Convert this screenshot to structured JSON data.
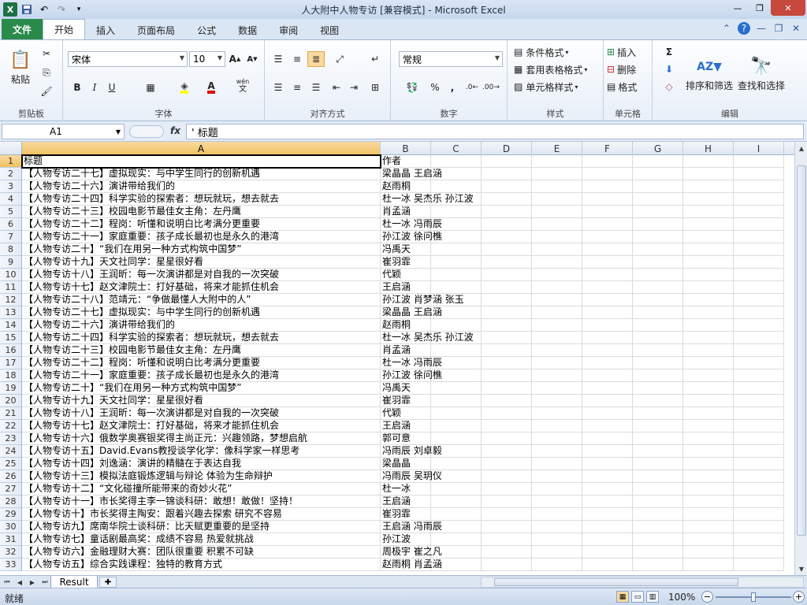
{
  "window": {
    "title": "人大附中人物专访  [兼容模式]  -  Microsoft Excel"
  },
  "qat": {
    "save_icon": "save-icon",
    "undo_icon": "undo-icon",
    "redo_icon": "redo-icon"
  },
  "tabs": [
    {
      "label": "文件"
    },
    {
      "label": "开始"
    },
    {
      "label": "插入"
    },
    {
      "label": "页面布局"
    },
    {
      "label": "公式"
    },
    {
      "label": "数据"
    },
    {
      "label": "审阅"
    },
    {
      "label": "视图"
    }
  ],
  "ribbon": {
    "clipboard": {
      "label": "剪贴板",
      "paste": "粘贴"
    },
    "font": {
      "label": "字体",
      "font_name": "宋体",
      "font_size": "10",
      "bold": "B",
      "italic": "I",
      "underline": "U",
      "wen": "wén"
    },
    "alignment": {
      "label": "对齐方式"
    },
    "number": {
      "label": "数字",
      "format": "常规"
    },
    "styles": {
      "label": "样式",
      "conditional": "条件格式",
      "table_format": "套用表格格式",
      "cell_style": "单元格样式"
    },
    "cells": {
      "label": "单元格",
      "insert": "插入",
      "delete": "删除",
      "format": "格式"
    },
    "editing": {
      "label": "编辑",
      "sort_filter": "排序和筛选",
      "find_select": "查找和选择",
      "sigma": "Σ"
    }
  },
  "formula_bar": {
    "name_box": "A1",
    "fx": "fx",
    "content": "' 标题"
  },
  "columns": [
    "A",
    "B",
    "C",
    "D",
    "E",
    "F",
    "G",
    "H",
    "I"
  ],
  "rows": [
    {
      "n": "1",
      "a": "标题",
      "b": "作者"
    },
    {
      "n": "2",
      "a": "【人物专访二十七】虚拟现实：与中学生同行的创新机遇",
      "b": "梁晶晶  王启涵"
    },
    {
      "n": "3",
      "a": "【人物专访二十六】演讲带给我们的",
      "b": "赵雨桐"
    },
    {
      "n": "4",
      "a": "【人物专访二十四】科学实验的探索者：想玩就玩，想去就去",
      "b": "杜一冰  吴杰乐  孙江波"
    },
    {
      "n": "5",
      "a": "【人物专访二十三】校园电影节最佳女主角：左丹鹰",
      "b": "肖孟涵"
    },
    {
      "n": "6",
      "a": "【人物专访二十二】程岗：听懂和说明白比考满分更重要",
      "b": "杜一冰   冯雨辰"
    },
    {
      "n": "7",
      "a": "【人物专访二十一】家庭重要：孩子成长最初也是永久的港湾",
      "b": "孙江波  徐问樵"
    },
    {
      "n": "8",
      "a": "【人物专访二十】“我们在用另一种方式构筑中国梦”",
      "b": "冯禹天"
    },
    {
      "n": "9",
      "a": "【人物专访十九】天文社同学：星星很好看",
      "b": "崔羽霏"
    },
    {
      "n": "10",
      "a": "【人物专访十八】王润昕：每一次演讲都是对自我的一次突破",
      "b": "代颖"
    },
    {
      "n": "11",
      "a": "【人物专访十七】赵文津院士：打好基础，将来才能抓住机会",
      "b": "王启涵"
    },
    {
      "n": "12",
      "a": "【人物专访二十八】范靖元：“争做最懂人大附中的人”",
      "b": "孙江波   肖梦涵   张玉"
    },
    {
      "n": "13",
      "a": "【人物专访二十七】虚拟现实：与中学生同行的创新机遇",
      "b": "梁晶晶  王启涵"
    },
    {
      "n": "14",
      "a": "【人物专访二十六】演讲带给我们的",
      "b": "赵雨桐"
    },
    {
      "n": "15",
      "a": "【人物专访二十四】科学实验的探索者：想玩就玩，想去就去",
      "b": "杜一冰  吴杰乐  孙江波"
    },
    {
      "n": "16",
      "a": "【人物专访二十三】校园电影节最佳女主角：左丹鹰",
      "b": "肖孟涵"
    },
    {
      "n": "17",
      "a": "【人物专访二十二】程岗：听懂和说明白比考满分更重要",
      "b": "杜一冰   冯雨辰"
    },
    {
      "n": "18",
      "a": "【人物专访二十一】家庭重要：孩子成长最初也是永久的港湾",
      "b": "孙江波  徐问樵"
    },
    {
      "n": "19",
      "a": "【人物专访二十】“我们在用另一种方式构筑中国梦”",
      "b": "冯禹天"
    },
    {
      "n": "20",
      "a": "【人物专访十九】天文社同学：星星很好看",
      "b": "崔羽霏"
    },
    {
      "n": "21",
      "a": "【人物专访十八】王润昕：每一次演讲都是对自我的一次突破",
      "b": "代颖"
    },
    {
      "n": "22",
      "a": "【人物专访十七】赵文津院士：打好基础，将来才能抓住机会",
      "b": "王启涵"
    },
    {
      "n": "23",
      "a": "【人物专访十六】俄数学奥赛银奖得主尚正元：兴趣领路，梦想启航",
      "b": "郭可意"
    },
    {
      "n": "24",
      "a": "【人物专访十五】David.Evans教授谈学化学：像科学家一样思考",
      "b": "冯雨辰  刘卓毅"
    },
    {
      "n": "25",
      "a": "【人物专访十四】刘逸涵：演讲的精髓在于表达自我",
      "b": "梁晶晶"
    },
    {
      "n": "26",
      "a": "【人物专访十三】模拟法庭锻炼逻辑与辩论 体验为生命辩护",
      "b": "冯雨辰  吴玥仪"
    },
    {
      "n": "27",
      "a": "【人物专访十二】“文化碰撞所能带来的奇妙火花”",
      "b": "杜一冰"
    },
    {
      "n": "28",
      "a": "【人物专访十一】市长奖得主李一锦谈科研：敢想！敢做！坚持！",
      "b": "王启涵"
    },
    {
      "n": "29",
      "a": "【人物专访十】市长奖得主陶安：跟着兴趣去探索  研究不容易",
      "b": "崔羽霏"
    },
    {
      "n": "30",
      "a": "【人物专访九】席南华院士谈科研：比天赋更重要的是坚持",
      "b": "王启涵  冯雨辰"
    },
    {
      "n": "31",
      "a": "【人物专访七】童话剧最高奖：成绩不容易  热爱就挑战",
      "b": "孙江波"
    },
    {
      "n": "32",
      "a": "【人物专访六】金融理财大赛：团队很重要  积累不可缺",
      "b": "周极宇  崔之凡"
    },
    {
      "n": "33",
      "a": "【人物专访五】综合实践课程：独特的教育方式",
      "b": "赵雨桐   肖孟涵"
    }
  ],
  "sheet": {
    "name": "Result"
  },
  "status": {
    "ready": "就绪",
    "zoom": "100%"
  }
}
